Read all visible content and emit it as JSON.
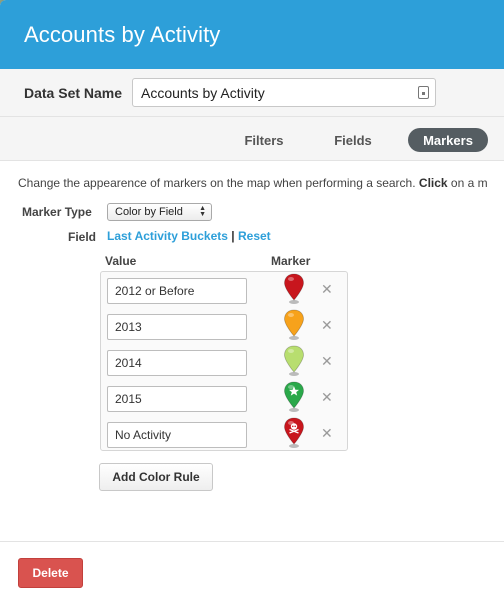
{
  "modal": {
    "title": "Accounts by Activity"
  },
  "dataset": {
    "label": "Data Set Name",
    "value": "Accounts by Activity"
  },
  "tabs": [
    {
      "label": "Filters",
      "active": false
    },
    {
      "label": "Fields",
      "active": false
    },
    {
      "label": "Markers",
      "active": true
    }
  ],
  "markers": {
    "help_prefix": "Change the appearence of markers on the map when performing a search. ",
    "help_bold": "Click",
    "help_suffix": " on a m",
    "marker_type_label": "Marker Type",
    "marker_type_value": "Color by Field",
    "field_label": "Field",
    "field_link": "Last Activity Buckets",
    "separator": "|",
    "reset_link": "Reset",
    "value_header": "Value",
    "marker_header": "Marker",
    "rules": [
      {
        "value": "2012 or Before",
        "color": "#c8161d",
        "symbol": "none",
        "remove": "✕"
      },
      {
        "value": "2013",
        "color": "#f7a21b",
        "symbol": "none",
        "remove": "✕"
      },
      {
        "value": "2014",
        "color": "#b8de6f",
        "symbol": "none",
        "remove": "✕"
      },
      {
        "value": "2015",
        "color": "#2aa84a",
        "symbol": "star",
        "remove": "✕"
      },
      {
        "value": "No Activity",
        "color": "#c8161d",
        "symbol": "skull",
        "remove": "✕"
      }
    ],
    "add_rule_label": "Add Color Rule"
  },
  "footer": {
    "delete_label": "Delete",
    "delete_color": "#d9534f"
  },
  "colors": {
    "header": "#2d9fd9",
    "link": "#2d9fd9"
  }
}
